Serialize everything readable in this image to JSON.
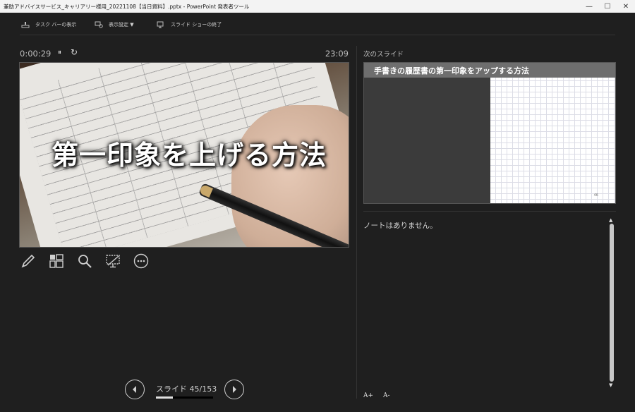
{
  "window": {
    "title": "兼助アドバイスサービス_キャリアリー様用_20221108【当日資料】.pptx - PowerPoint 発表者ツール",
    "minimize": "—",
    "maximize": "☐",
    "close": "✕"
  },
  "toolbar": {
    "taskbar_label": "タスク バーの表示",
    "display_settings_label": "表示設定 ▼",
    "end_show_label": "スライド ショーの終了"
  },
  "timer": {
    "elapsed": "0:00:29",
    "pause_icon": "⏸",
    "reset_icon": "↻",
    "clock": "23:09"
  },
  "current_slide": {
    "headline": "第一印象を上げる方法"
  },
  "tools": [
    "pen-icon",
    "see-all-slides-icon",
    "zoom-icon",
    "black-screen-icon",
    "more-options-icon"
  ],
  "next": {
    "label": "次のスライド",
    "title": "手書きの履歴書の第一印象をアップする方法",
    "page": "46"
  },
  "notes": {
    "text": "ノートはありません。"
  },
  "navigation": {
    "counter": "スライド 45/153",
    "progress": 0.294
  },
  "font_buttons": {
    "increase": "A+",
    "decrease": "A-"
  }
}
